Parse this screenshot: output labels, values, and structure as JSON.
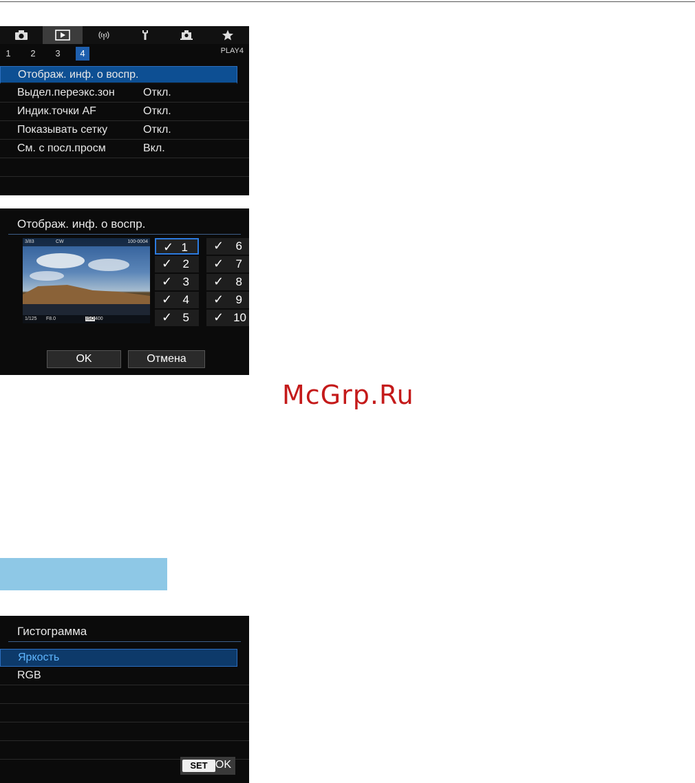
{
  "menu_screen": {
    "tabs": [
      {
        "icon": "camera-icon"
      },
      {
        "icon": "playback-icon",
        "active": true
      },
      {
        "icon": "wireless-icon"
      },
      {
        "icon": "wrench-icon"
      },
      {
        "icon": "custom-function-icon"
      },
      {
        "icon": "star-icon"
      }
    ],
    "subtabs": [
      "1",
      "2",
      "3",
      "4"
    ],
    "active_subtab": "4",
    "page_label": "PLAY4",
    "items": [
      {
        "label": "Отображ. инф. о воспр.",
        "value": ""
      },
      {
        "label": "Выдел.переэкс.зон",
        "value": "Откл."
      },
      {
        "label": "Индик.точки AF",
        "value": "Откл."
      },
      {
        "label": "Показывать сетку",
        "value": "Откл."
      },
      {
        "label": "См. с посл.просм",
        "value": "Вкл."
      }
    ]
  },
  "info_screen": {
    "title": "Отображ. инф. о воспр.",
    "preview": {
      "top_left": "3/83",
      "top_mid": "CW",
      "top_right": "100-0004",
      "bottom_left": "1/125",
      "bottom_mid": "F8.0",
      "bottom_iso": "ISO",
      "bottom_iso_val": "400"
    },
    "checkboxes": [
      {
        "num": "1",
        "checked": true,
        "tick": "✓"
      },
      {
        "num": "2",
        "checked": true,
        "tick": "✓"
      },
      {
        "num": "3",
        "checked": true,
        "tick": "✓"
      },
      {
        "num": "4",
        "checked": true,
        "tick": "✓"
      },
      {
        "num": "5",
        "checked": true,
        "tick": "✓"
      },
      {
        "num": "6",
        "checked": true,
        "tick": "✓"
      },
      {
        "num": "7",
        "checked": true,
        "tick": "✓"
      },
      {
        "num": "8",
        "checked": true,
        "tick": "✓"
      },
      {
        "num": "9",
        "checked": true,
        "tick": "✓"
      },
      {
        "num": "10",
        "checked": true,
        "tick": "✓"
      }
    ],
    "ok_label": "OK",
    "cancel_label": "Отмена"
  },
  "watermark": "McGrp.Ru",
  "histogram_screen": {
    "title": "Гистограмма",
    "options": [
      "Яркость",
      "RGB"
    ],
    "selected": "Яркость",
    "set_label": "SET",
    "set_ok": "OK"
  },
  "colors": {
    "selection_blue": "#0d4f93",
    "watermark_red": "#c41a1a",
    "bar_blue": "#8ec8e6"
  }
}
